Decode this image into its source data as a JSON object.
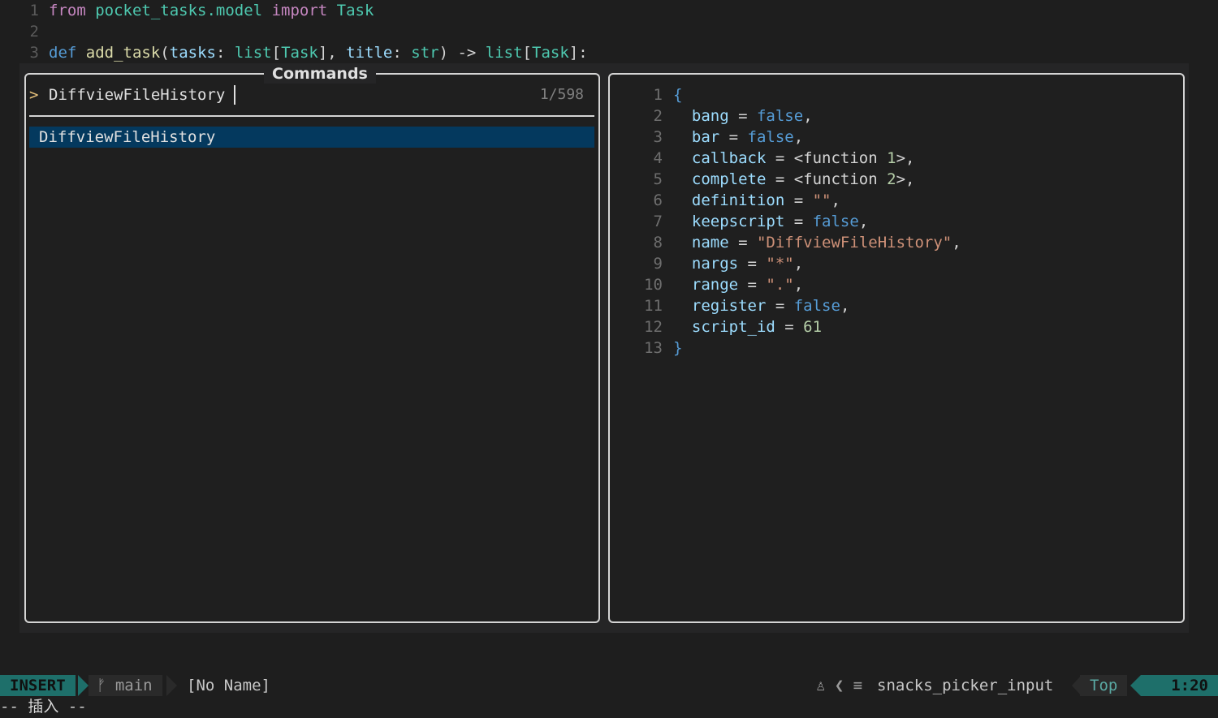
{
  "editor": {
    "lines": [
      {
        "num": "1",
        "tokens": [
          {
            "t": "from",
            "c": "kw"
          },
          {
            "t": " ",
            "c": "punc"
          },
          {
            "t": "pocket_tasks.model",
            "c": "mod"
          },
          {
            "t": " ",
            "c": "punc"
          },
          {
            "t": "import",
            "c": "kw"
          },
          {
            "t": " ",
            "c": "punc"
          },
          {
            "t": "Task",
            "c": "typ"
          }
        ]
      },
      {
        "num": "2",
        "tokens": []
      },
      {
        "num": "3",
        "tokens": [
          {
            "t": "def",
            "c": "kwb"
          },
          {
            "t": " ",
            "c": "punc"
          },
          {
            "t": "add_task",
            "c": "fn"
          },
          {
            "t": "(",
            "c": "punc"
          },
          {
            "t": "tasks",
            "c": "param"
          },
          {
            "t": ": ",
            "c": "punc"
          },
          {
            "t": "list",
            "c": "typ"
          },
          {
            "t": "[",
            "c": "punc"
          },
          {
            "t": "Task",
            "c": "typ"
          },
          {
            "t": "], ",
            "c": "punc"
          },
          {
            "t": "title",
            "c": "param"
          },
          {
            "t": ": ",
            "c": "punc"
          },
          {
            "t": "str",
            "c": "typ"
          },
          {
            "t": ") -> ",
            "c": "punc"
          },
          {
            "t": "list",
            "c": "typ"
          },
          {
            "t": "[",
            "c": "punc"
          },
          {
            "t": "Task",
            "c": "typ"
          },
          {
            "t": "]:",
            "c": "punc"
          }
        ]
      }
    ]
  },
  "picker": {
    "title": "Commands",
    "prompt_icon": ">",
    "query": "DiffviewFileHistory",
    "count": "1/598",
    "results": [
      "DiffviewFileHistory"
    ]
  },
  "preview": {
    "lines": [
      {
        "num": "1",
        "tokens": [
          {
            "t": "{",
            "c": "brace"
          }
        ]
      },
      {
        "num": "2",
        "tokens": [
          {
            "t": "  ",
            "c": "punc"
          },
          {
            "t": "bang",
            "c": "key"
          },
          {
            "t": " = ",
            "c": "punc"
          },
          {
            "t": "false",
            "c": "bool"
          },
          {
            "t": ",",
            "c": "punc"
          }
        ]
      },
      {
        "num": "3",
        "tokens": [
          {
            "t": "  ",
            "c": "punc"
          },
          {
            "t": "bar",
            "c": "key"
          },
          {
            "t": " = ",
            "c": "punc"
          },
          {
            "t": "false",
            "c": "bool"
          },
          {
            "t": ",",
            "c": "punc"
          }
        ]
      },
      {
        "num": "4",
        "tokens": [
          {
            "t": "  ",
            "c": "punc"
          },
          {
            "t": "callback",
            "c": "key"
          },
          {
            "t": " = <function ",
            "c": "punc"
          },
          {
            "t": "1",
            "c": "num"
          },
          {
            "t": ">,",
            "c": "punc"
          }
        ]
      },
      {
        "num": "5",
        "tokens": [
          {
            "t": "  ",
            "c": "punc"
          },
          {
            "t": "complete",
            "c": "key"
          },
          {
            "t": " = <function ",
            "c": "punc"
          },
          {
            "t": "2",
            "c": "num"
          },
          {
            "t": ">,",
            "c": "punc"
          }
        ]
      },
      {
        "num": "6",
        "tokens": [
          {
            "t": "  ",
            "c": "punc"
          },
          {
            "t": "definition",
            "c": "key"
          },
          {
            "t": " = ",
            "c": "punc"
          },
          {
            "t": "\"\"",
            "c": "str"
          },
          {
            "t": ",",
            "c": "punc"
          }
        ]
      },
      {
        "num": "7",
        "tokens": [
          {
            "t": "  ",
            "c": "punc"
          },
          {
            "t": "keepscript",
            "c": "key"
          },
          {
            "t": " = ",
            "c": "punc"
          },
          {
            "t": "false",
            "c": "bool"
          },
          {
            "t": ",",
            "c": "punc"
          }
        ]
      },
      {
        "num": "8",
        "tokens": [
          {
            "t": "  ",
            "c": "punc"
          },
          {
            "t": "name",
            "c": "key"
          },
          {
            "t": " = ",
            "c": "punc"
          },
          {
            "t": "\"DiffviewFileHistory\"",
            "c": "str"
          },
          {
            "t": ",",
            "c": "punc"
          }
        ]
      },
      {
        "num": "9",
        "tokens": [
          {
            "t": "  ",
            "c": "punc"
          },
          {
            "t": "nargs",
            "c": "key"
          },
          {
            "t": " = ",
            "c": "punc"
          },
          {
            "t": "\"*\"",
            "c": "str"
          },
          {
            "t": ",",
            "c": "punc"
          }
        ]
      },
      {
        "num": "10",
        "tokens": [
          {
            "t": "  ",
            "c": "punc"
          },
          {
            "t": "range",
            "c": "key"
          },
          {
            "t": " = ",
            "c": "punc"
          },
          {
            "t": "\".\"",
            "c": "str"
          },
          {
            "t": ",",
            "c": "punc"
          }
        ]
      },
      {
        "num": "11",
        "tokens": [
          {
            "t": "  ",
            "c": "punc"
          },
          {
            "t": "register",
            "c": "key"
          },
          {
            "t": " = ",
            "c": "punc"
          },
          {
            "t": "false",
            "c": "bool"
          },
          {
            "t": ",",
            "c": "punc"
          }
        ]
      },
      {
        "num": "12",
        "tokens": [
          {
            "t": "  ",
            "c": "punc"
          },
          {
            "t": "script_id",
            "c": "key"
          },
          {
            "t": " = ",
            "c": "punc"
          },
          {
            "t": "61",
            "c": "num"
          }
        ]
      },
      {
        "num": "13",
        "tokens": [
          {
            "t": "}",
            "c": "brace"
          }
        ]
      }
    ]
  },
  "statusline": {
    "mode": "INSERT",
    "branch_icon": "ᚠ",
    "branch": "main",
    "filename": "[No Name]",
    "filetype_icons": "♙ ❮ ≡",
    "filetype": "snacks_picker_input",
    "position": "Top",
    "location": "1:20"
  },
  "cmdline": {
    "text": "-- 插入 --"
  },
  "colors": {
    "mode_bg": "#1e6f6a",
    "selection_bg": "#04395e",
    "background": "#1e1e1e"
  }
}
